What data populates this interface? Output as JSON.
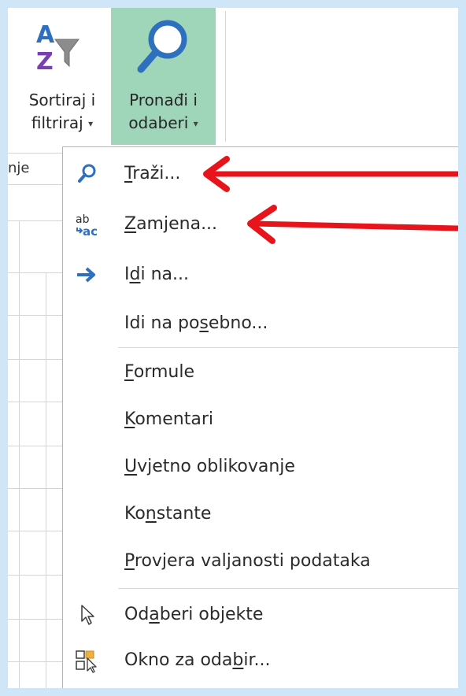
{
  "ribbon": {
    "sort_filter": {
      "line1": "Sortiraj i",
      "line2": "filtriraj"
    },
    "find_select": {
      "line1": "Pronađi i",
      "line2": "odaberi"
    },
    "dropdown_glyph": "▾",
    "group_fragment": "nje"
  },
  "menu": {
    "items": [
      {
        "pre": "",
        "u": "T",
        "post": "raži...",
        "icon": "magnifier-icon"
      },
      {
        "pre": "",
        "u": "Z",
        "post": "amjena...",
        "icon": "replace-icon"
      },
      {
        "pre": "I",
        "u": "d",
        "post": "i na...",
        "icon": "go-to-arrow-icon"
      },
      {
        "pre": "Idi na po",
        "u": "s",
        "post": "ebno...",
        "icon": ""
      },
      {
        "pre": "",
        "u": "F",
        "post": "ormule",
        "icon": ""
      },
      {
        "pre": "",
        "u": "K",
        "post": "omentari",
        "icon": ""
      },
      {
        "pre": "",
        "u": "U",
        "post": "vjetno oblikovanje",
        "icon": ""
      },
      {
        "pre": "Ko",
        "u": "n",
        "post": "stante",
        "icon": ""
      },
      {
        "pre": "",
        "u": "P",
        "post": "rovjera valjanosti podataka",
        "icon": ""
      },
      {
        "pre": "Od",
        "u": "a",
        "post": "beri objekte",
        "icon": "select-objects-cursor-icon"
      },
      {
        "pre": "Okno za oda",
        "u": "b",
        "post": "ir...",
        "icon": "selection-pane-icon"
      }
    ]
  },
  "colors": {
    "highlight": "#9fd5b8",
    "annotation_arrow": "#e8141b",
    "icon_blue": "#2e6fbe",
    "background": "#cfe6f8"
  }
}
